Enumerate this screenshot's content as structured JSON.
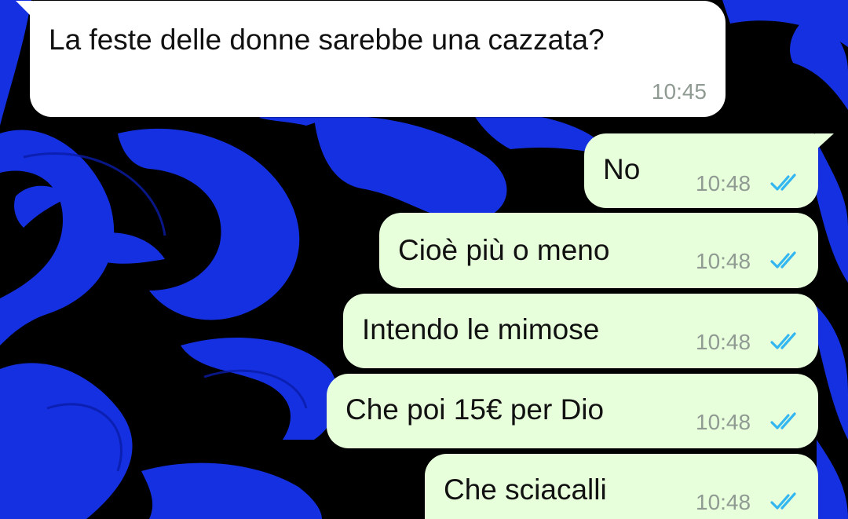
{
  "theme": {
    "wallpaper_bg": "#000000",
    "wallpaper_swirl": "#1430e0",
    "incoming_bubble": "#ffffff",
    "outgoing_bubble": "#e7ffdb",
    "read_check_color": "#34b7f1"
  },
  "messages": [
    {
      "direction": "incoming",
      "text": "La feste delle donne sarebbe una cazzata?",
      "time": "10:45"
    },
    {
      "direction": "outgoing",
      "text": "No",
      "time": "10:48",
      "status": "read-double-check-icon"
    },
    {
      "direction": "outgoing",
      "text": "Cioè più o meno",
      "time": "10:48",
      "status": "read-double-check-icon"
    },
    {
      "direction": "outgoing",
      "text": "Intendo le mimose",
      "time": "10:48",
      "status": "read-double-check-icon"
    },
    {
      "direction": "outgoing",
      "text": "Che poi 15€ per Dio",
      "time": "10:48",
      "status": "read-double-check-icon"
    },
    {
      "direction": "outgoing",
      "text": "Che sciacalli",
      "time": "10:48",
      "status": "read-double-check-icon"
    }
  ]
}
